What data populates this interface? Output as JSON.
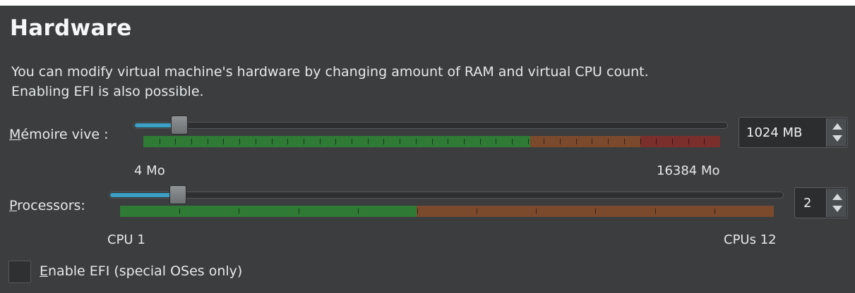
{
  "header": {
    "title": "Hardware"
  },
  "description": {
    "line1": "You can modify virtual machine's hardware by changing amount of RAM and virtual CPU count.",
    "line2": "Enabling EFI is also possible."
  },
  "memory": {
    "label_mnemonic": "M",
    "label_rest": "émoire vive :",
    "min_label": "4 Mo",
    "max_label": "16384 Mo",
    "spin_value": "1024 MB",
    "slider_fraction": 0.0625
  },
  "processors": {
    "label_mnemonic": "P",
    "label_rest": "rocessors:",
    "min_label": "CPU 1",
    "max_label": "CPUs 12",
    "spin_value": "2",
    "slider_fraction": 0.0909
  },
  "efi": {
    "label_mnemonic": "E",
    "label_rest": "nable EFI (special OSes only)",
    "checked": false
  },
  "colors": {
    "panel_bg": "#3b3d3f",
    "slider_fill": "#3ba0c4",
    "band_green": "#2f7a35",
    "band_orange": "#7b4a2d",
    "band_red": "#7a2f2c"
  },
  "icons": {
    "spin_up": "chevron-up-icon",
    "spin_down": "chevron-down-icon"
  }
}
